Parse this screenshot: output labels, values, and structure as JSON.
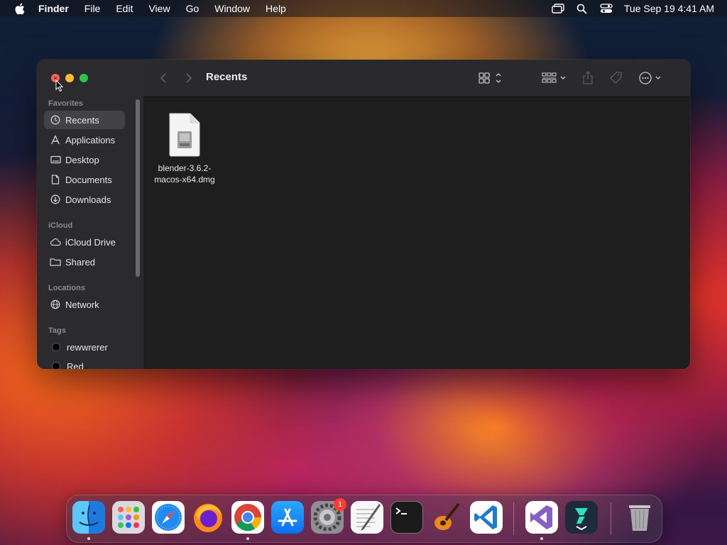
{
  "menubar": {
    "app_name": "Finder",
    "menus": [
      "File",
      "Edit",
      "View",
      "Go",
      "Window",
      "Help"
    ],
    "clock": "Tue Sep 19  4:41 AM",
    "status_icons": [
      "screen-mirroring-icon",
      "spotlight-search-icon",
      "control-center-icon"
    ]
  },
  "finder": {
    "title": "Recents",
    "sidebar": {
      "favorites_label": "Favorites",
      "favorites": [
        {
          "label": "Recents",
          "icon": "clock-icon",
          "selected": true
        },
        {
          "label": "Applications",
          "icon": "applications-icon"
        },
        {
          "label": "Desktop",
          "icon": "desktop-icon"
        },
        {
          "label": "Documents",
          "icon": "document-icon"
        },
        {
          "label": "Downloads",
          "icon": "download-icon"
        }
      ],
      "icloud_label": "iCloud",
      "icloud": [
        {
          "label": "iCloud Drive",
          "icon": "cloud-icon"
        },
        {
          "label": "Shared",
          "icon": "shared-folder-icon"
        }
      ],
      "locations_label": "Locations",
      "locations": [
        {
          "label": "Network",
          "icon": "globe-icon"
        }
      ],
      "tags_label": "Tags",
      "tags": [
        {
          "label": "rewwrerer",
          "color": "#000000"
        },
        {
          "label": "Red",
          "color": "#000000"
        }
      ]
    },
    "files": [
      {
        "name_line1": "blender-3.6.2-",
        "name_line2": "macos-x64.dmg",
        "icon": "disk-image-icon"
      }
    ]
  },
  "dock": {
    "apps": [
      "Finder",
      "Launchpad",
      "Safari",
      "Firefox",
      "Chrome",
      "App Store",
      "System Settings",
      "TextEdit",
      "Terminal",
      "GarageBand",
      "Visual Studio Code",
      "Visual Studio",
      "Filmora",
      "Trash"
    ],
    "settings_badge": "1"
  },
  "colors": {
    "accent_close": "#ff5f57",
    "accent_minimize": "#febc2e",
    "accent_zoom": "#28c840",
    "badge": "#ff3b30"
  }
}
